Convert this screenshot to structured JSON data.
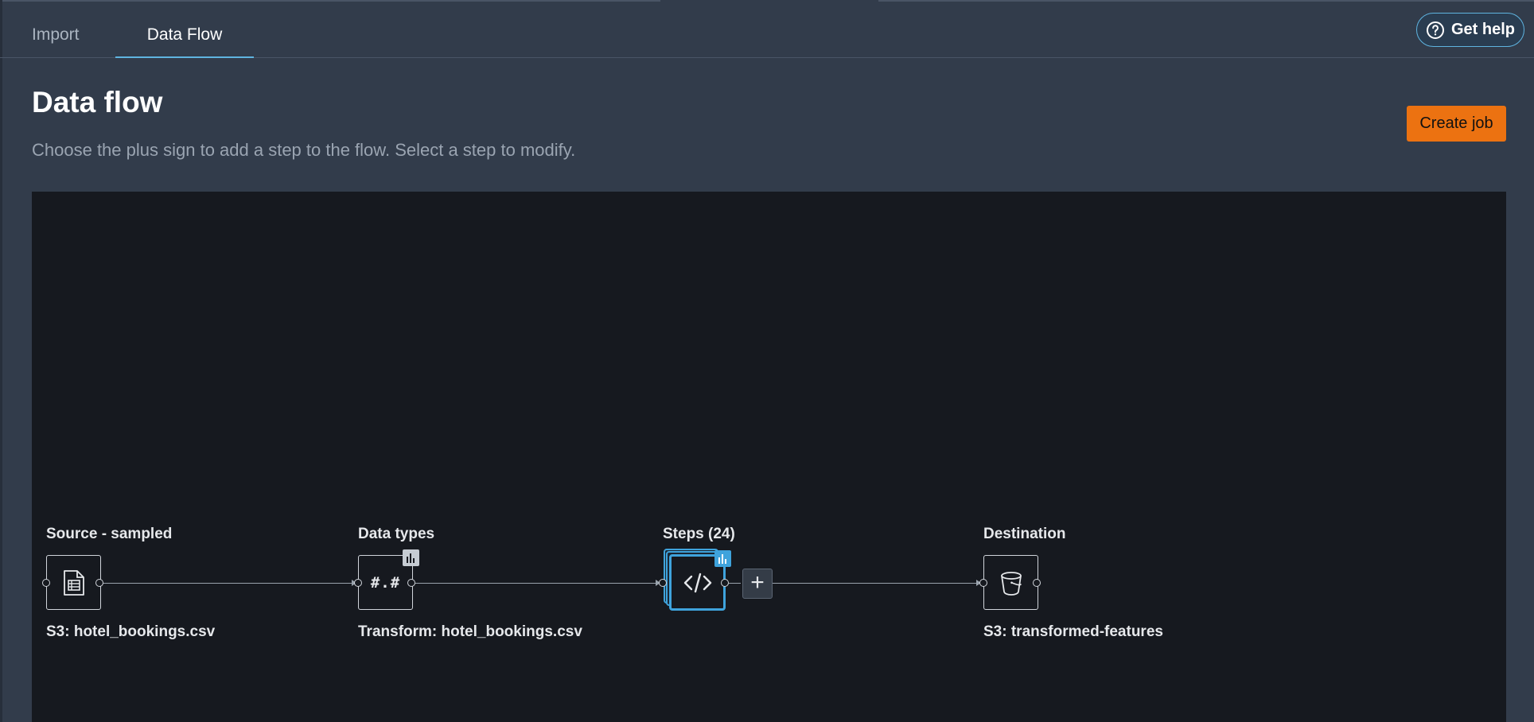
{
  "tabs": [
    {
      "label": "Import"
    },
    {
      "label": "Data Flow"
    }
  ],
  "help": {
    "label": "Get help"
  },
  "header": {
    "title": "Data flow",
    "description": "Choose the plus sign to add a step to the flow. Select a step to modify.",
    "create_job_label": "Create job"
  },
  "nodes": {
    "source": {
      "title": "Source - sampled",
      "subtitle": "S3: hotel_bookings.csv",
      "icon": "table-file-icon"
    },
    "datatypes": {
      "title": "Data types",
      "subtitle": "Transform: hotel_bookings.csv",
      "icon_text": "#.#"
    },
    "steps": {
      "title": "Steps (24)",
      "icon": "code-icon"
    },
    "destination": {
      "title": "Destination",
      "subtitle": "S3: transformed-features",
      "icon": "bucket-icon"
    }
  },
  "add_step": {
    "label": "+"
  },
  "colors": {
    "accent": "#3fa3dc",
    "primary_button": "#ec7211",
    "canvas": "#16191f",
    "background": "#323c4b"
  }
}
